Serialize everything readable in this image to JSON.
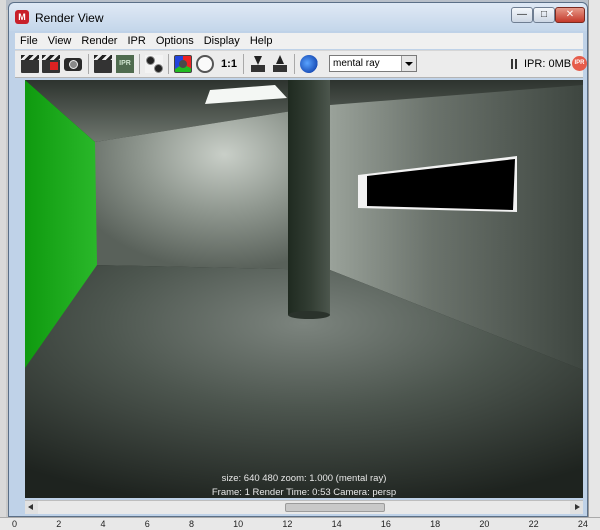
{
  "window": {
    "title": "Render View"
  },
  "menu": [
    "File",
    "View",
    "Render",
    "IPR",
    "Options",
    "Display",
    "Help"
  ],
  "toolbar": {
    "ratio_label": "1:1",
    "ipr_tile_label": "IPR",
    "renderer_value": "mental ray",
    "ipr_memory": "IPR: 0MB",
    "ipr_badge": "IPR"
  },
  "render_status": {
    "line1": "size:  640  480 zoom: 1.000       (mental ray)",
    "line2": "Frame: 1      Render Time: 0:53      Camera: persp"
  },
  "background_ruler": [
    "0",
    "2",
    "4",
    "6",
    "8",
    "10",
    "12",
    "14",
    "16",
    "18",
    "20",
    "22",
    "24"
  ],
  "colors": {
    "green_wall": "#1fa41f",
    "room_grey": "#55605a",
    "window_frame_blue": "#bfd2e8"
  }
}
